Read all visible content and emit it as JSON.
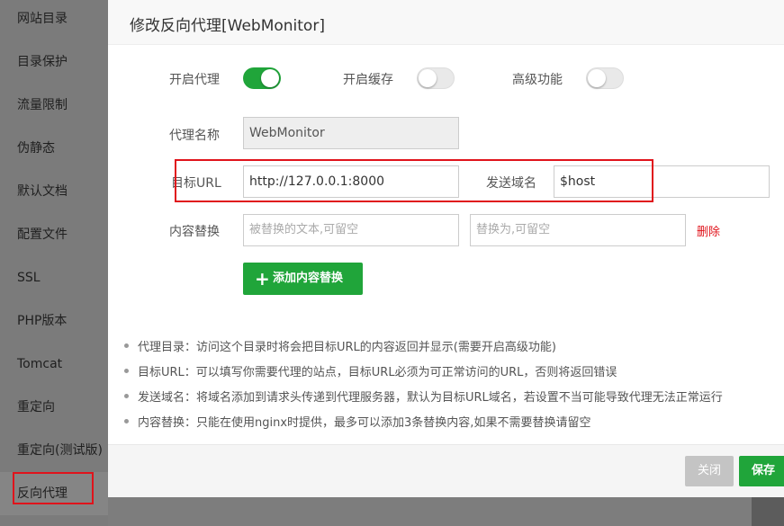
{
  "sidebar": {
    "items": [
      {
        "label": "网站目录"
      },
      {
        "label": "目录保护"
      },
      {
        "label": "流量限制"
      },
      {
        "label": "伪静态"
      },
      {
        "label": "默认文档"
      },
      {
        "label": "配置文件"
      },
      {
        "label": "SSL"
      },
      {
        "label": "PHP版本"
      },
      {
        "label": "Tomcat"
      },
      {
        "label": "重定向"
      },
      {
        "label": "重定向(测试版)"
      },
      {
        "label": "反向代理"
      }
    ],
    "active_index": 11
  },
  "dialog": {
    "title": "修改反向代理[WebMonitor]",
    "toggles": {
      "enable_proxy": {
        "label": "开启代理",
        "on": true
      },
      "enable_cache": {
        "label": "开启缓存",
        "on": false
      },
      "advanced": {
        "label": "高级功能",
        "on": false
      }
    },
    "proxy_name": {
      "label": "代理名称",
      "value": "WebMonitor"
    },
    "target_url": {
      "label": "目标URL",
      "value": "http://127.0.0.1:8000"
    },
    "send_domain": {
      "label": "发送域名",
      "value": "$host"
    },
    "content_replace": {
      "label": "内容替换",
      "from_placeholder": "被替换的文本,可留空",
      "to_placeholder": "替换为,可留空",
      "delete_label": "删除"
    },
    "add_replace_button": "添加内容替换",
    "notes": [
      "代理目录：访问这个目录时将会把目标URL的内容返回并显示(需要开启高级功能)",
      "目标URL：可以填写你需要代理的站点，目标URL必须为可正常访问的URL，否则将返回错误",
      "发送域名：将域名添加到请求头传递到代理服务器，默认为目标URL域名，若设置不当可能导致代理无法正常运行",
      "内容替换：只能在使用nginx时提供，最多可以添加3条替换内容,如果不需要替换请留空"
    ],
    "buttons": {
      "close": "关闭",
      "save": "保存"
    }
  },
  "colors": {
    "accent": "#20a53a",
    "highlight": "#e0131b"
  }
}
